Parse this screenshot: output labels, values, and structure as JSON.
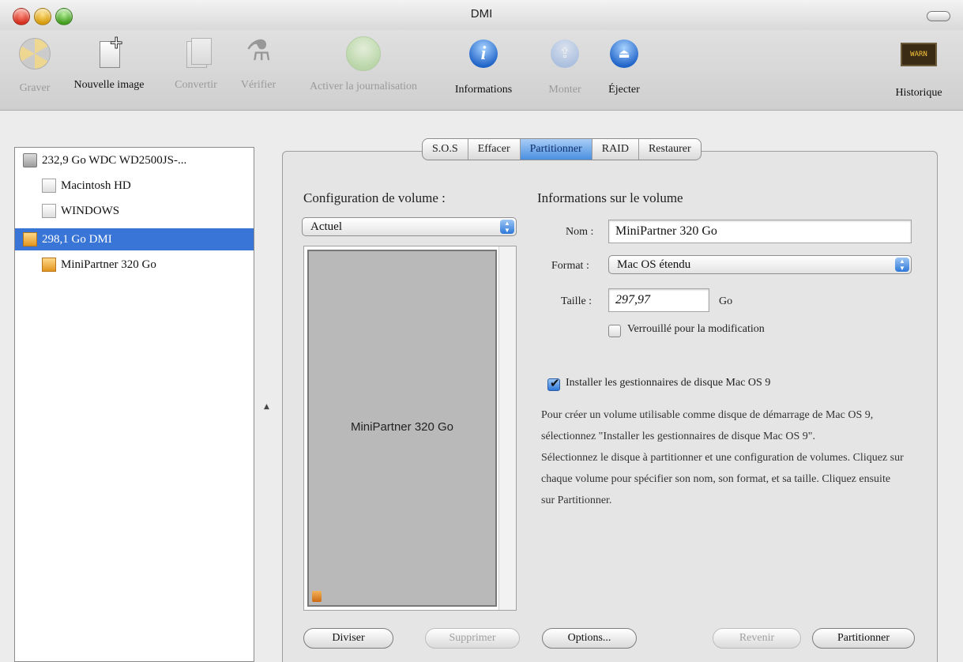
{
  "window": {
    "title": "DMI"
  },
  "toolbar": {
    "items": [
      {
        "label": "Graver",
        "icon": "burn-icon",
        "enabled": false
      },
      {
        "label": "Nouvelle image",
        "icon": "new-image-icon",
        "enabled": true
      },
      {
        "label": "Convertir",
        "icon": "convert-icon",
        "enabled": false
      },
      {
        "label": "Vérifier",
        "icon": "microscope-icon",
        "enabled": false
      },
      {
        "label": "Activer la journalisation",
        "icon": "journaling-icon",
        "enabled": false
      },
      {
        "label": "Informations",
        "icon": "info-icon",
        "enabled": true
      },
      {
        "label": "Monter",
        "icon": "mount-icon",
        "enabled": false
      },
      {
        "label": "Éjecter",
        "icon": "eject-icon",
        "enabled": true
      },
      {
        "label": "Historique",
        "icon": "log-icon",
        "enabled": true
      }
    ],
    "log_icon_text": "WARN 9:41"
  },
  "sidebar": {
    "items": [
      {
        "label": "232,9 Go WDC WD2500JS-...",
        "level": 0,
        "icon": "hard-disk-icon",
        "selected": false
      },
      {
        "label": "Macintosh HD",
        "level": 1,
        "icon": "volume-icon",
        "selected": false
      },
      {
        "label": "WINDOWS",
        "level": 1,
        "icon": "volume-icon",
        "selected": false
      },
      {
        "label": "298,1 Go DMI",
        "level": 0,
        "icon": "disk-image-icon",
        "selected": true
      },
      {
        "label": "MiniPartner 320 Go",
        "level": 1,
        "icon": "disk-image-icon",
        "selected": false
      }
    ]
  },
  "tabs": [
    {
      "label": "S.O.S",
      "active": false
    },
    {
      "label": "Effacer",
      "active": false
    },
    {
      "label": "Partitionner",
      "active": true
    },
    {
      "label": "RAID",
      "active": false
    },
    {
      "label": "Restaurer",
      "active": false
    }
  ],
  "partition": {
    "config_label": "Configuration de volume :",
    "config_value": "Actuel",
    "volume_name_in_map": "MiniPartner 320 Go",
    "info_heading": "Informations sur le volume",
    "name_label": "Nom :",
    "name_value": "MiniPartner 320 Go",
    "format_label": "Format :",
    "format_value": "Mac OS étendu",
    "size_label": "Taille :",
    "size_value": "297,97",
    "size_unit": "Go",
    "locked_label": "Verrouillé pour la modification",
    "locked_checked": false,
    "install_drivers_label": "Installer les gestionnaires de disque Mac OS 9",
    "install_drivers_checked": true,
    "help_paragraph_1": "Pour créer un volume utilisable comme disque de démarrage de Mac OS 9, sélectionnez \"Installer les gestionnaires de disque Mac OS 9\".",
    "help_paragraph_2": "Sélectionnez le disque à partitionner et une configuration de volumes. Cliquez sur chaque volume pour spécifier son nom, son format, et sa taille. Cliquez ensuite sur Partitionner."
  },
  "buttons": {
    "split": "Diviser",
    "delete": "Supprimer",
    "options": "Options...",
    "revert": "Revenir",
    "partition": "Partitionner"
  },
  "colors": {
    "selection": "#3875d7",
    "tab_active": "#4a8fe0"
  }
}
